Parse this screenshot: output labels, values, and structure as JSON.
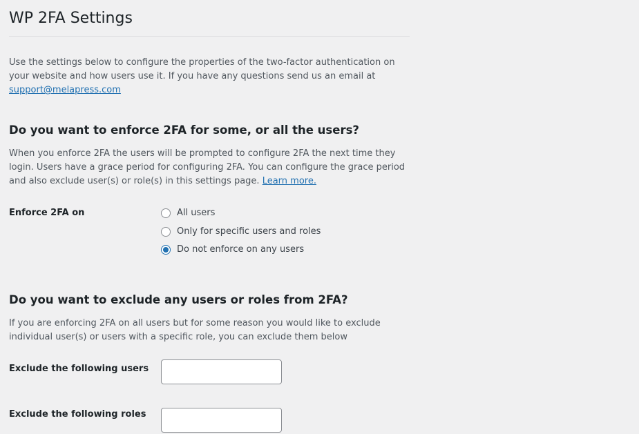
{
  "page": {
    "title": "WP 2FA Settings"
  },
  "intro": {
    "text": "Use the settings below to configure the properties of the two-factor authentication on your website and how users use it. If you have any questions send us an email at ",
    "email": "support@melapress.com"
  },
  "enforce_section": {
    "heading": "Do you want to enforce 2FA for some, or all the users?",
    "description": "When you enforce 2FA the users will be prompted to configure 2FA the next time they login. Users have a grace period for configuring 2FA. You can configure the grace period and also exclude user(s) or role(s) in this settings page. ",
    "learn_more": "Learn more.",
    "field_label": "Enforce 2FA on",
    "options": [
      {
        "label": "All users",
        "checked": false
      },
      {
        "label": "Only for specific users and roles",
        "checked": false
      },
      {
        "label": "Do not enforce on any users",
        "checked": true
      }
    ]
  },
  "exclude_section": {
    "heading": "Do you want to exclude any users or roles from 2FA?",
    "description": "If you are enforcing 2FA on all users but for some reason you would like to exclude individual user(s) or users with a specific role, you can exclude them below",
    "users_label": "Exclude the following users",
    "users_value": "",
    "roles_label": "Exclude the following roles",
    "roles_value": ""
  },
  "colors": {
    "background": "#f0f0f1",
    "accent": "#2271b1",
    "heading": "#1d2327",
    "text": "#50575e",
    "border": "#8c8f94"
  }
}
